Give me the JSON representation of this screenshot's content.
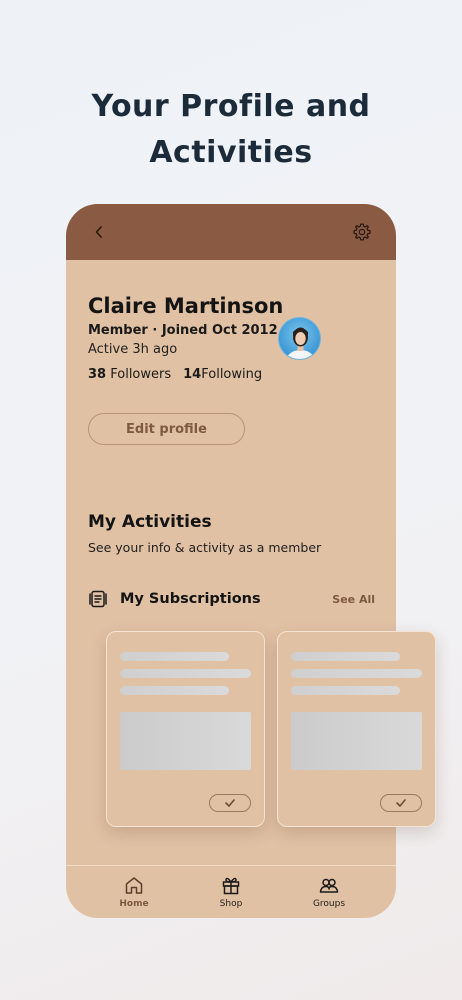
{
  "headline": [
    "Your Profile and",
    "Activities"
  ],
  "profile": {
    "name": "Claire Martinson",
    "member_line": "Member · Joined Oct 2012",
    "active": "Active 3h ago",
    "followers_count": "38",
    "followers_label": "Followers",
    "following_count": "14",
    "following_label": "Following",
    "edit_label": "Edit profile"
  },
  "activities": {
    "title": "My Activities",
    "subtitle": "See your info & activity as a member",
    "subscriptions_label": "My Subscriptions",
    "see_all": "See All"
  },
  "nav": {
    "items": [
      {
        "label": "Home",
        "icon": "home-icon",
        "active": true
      },
      {
        "label": "Shop",
        "icon": "gift-icon",
        "active": false
      },
      {
        "label": "Groups",
        "icon": "groups-icon",
        "active": false
      }
    ]
  },
  "colors": {
    "header": "#8b5a42",
    "surface": "#e1c1a4",
    "accent": "#7d5a40",
    "headline": "#1c2b3a"
  }
}
